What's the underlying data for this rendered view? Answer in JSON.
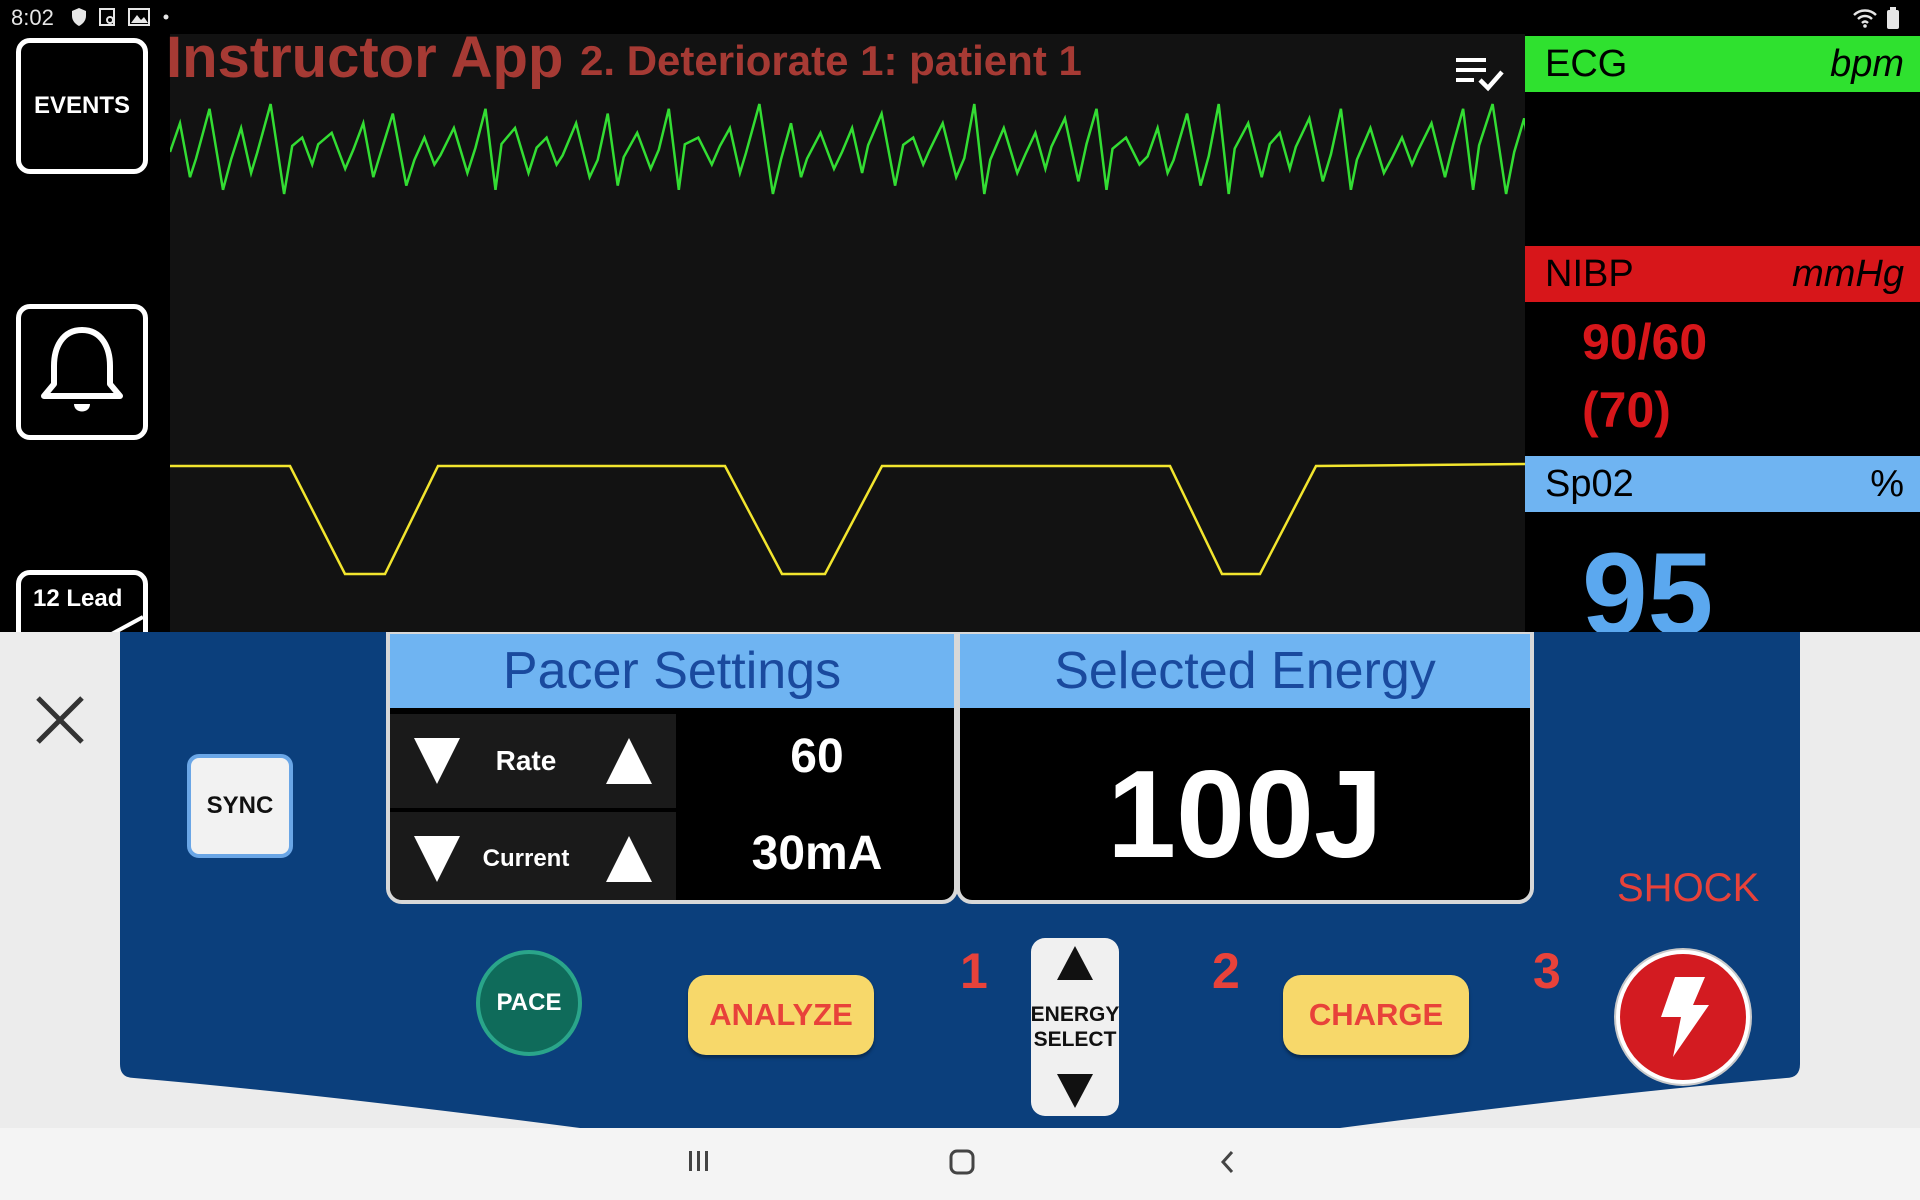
{
  "status_bar": {
    "time": "8:02",
    "icons": [
      "shield-icon",
      "screenshot-icon",
      "gallery-icon",
      "dot-icon",
      "wifi-icon",
      "battery-icon"
    ]
  },
  "sidebar": {
    "events_label": "EVENTS",
    "alarm_icon": "bell-icon",
    "lead_label": "12 Lead"
  },
  "header": {
    "app_title": "Instructor App",
    "scenario_title": "2. Deteriorate 1: patient 1",
    "menu_icon": "playlist-check-icon",
    "title_color": "#a63a34"
  },
  "waveforms": {
    "ecg_color": "#33dd33",
    "pleth_color": "#f2e52e"
  },
  "vitals": {
    "ecg": {
      "label": "ECG",
      "unit": "bpm",
      "value": "",
      "color": "#2fe12f"
    },
    "nibp": {
      "label": "NIBP",
      "unit": "mmHg",
      "value": "90/60",
      "mean": "(70)",
      "color": "#d7161a"
    },
    "spo2": {
      "label": "Sp02",
      "unit": "%",
      "value": "95",
      "color": "#6fb4f2"
    }
  },
  "controls": {
    "close_icon": "close-icon",
    "sync_label": "SYNC",
    "pacer": {
      "title": "Pacer Settings",
      "rate_label": "Rate",
      "rate_value": "60",
      "current_label": "Current",
      "current_value": "30mA"
    },
    "energy": {
      "title": "Selected Energy",
      "value": "100J"
    },
    "shock_label": "SHOCK",
    "steps": [
      "1",
      "2",
      "3"
    ],
    "pace_label": "PACE",
    "analyze_label": "ANALYZE",
    "energy_select_label_1": "ENERGY",
    "energy_select_label_2": "SELECT",
    "charge_label": "CHARGE",
    "shock_icon": "lightning-bolt-icon",
    "panel_color": "#0b3f7c"
  },
  "nav_bar": {
    "recent_icon": "recent-apps-icon",
    "home_icon": "home-icon",
    "back_icon": "back-icon"
  }
}
